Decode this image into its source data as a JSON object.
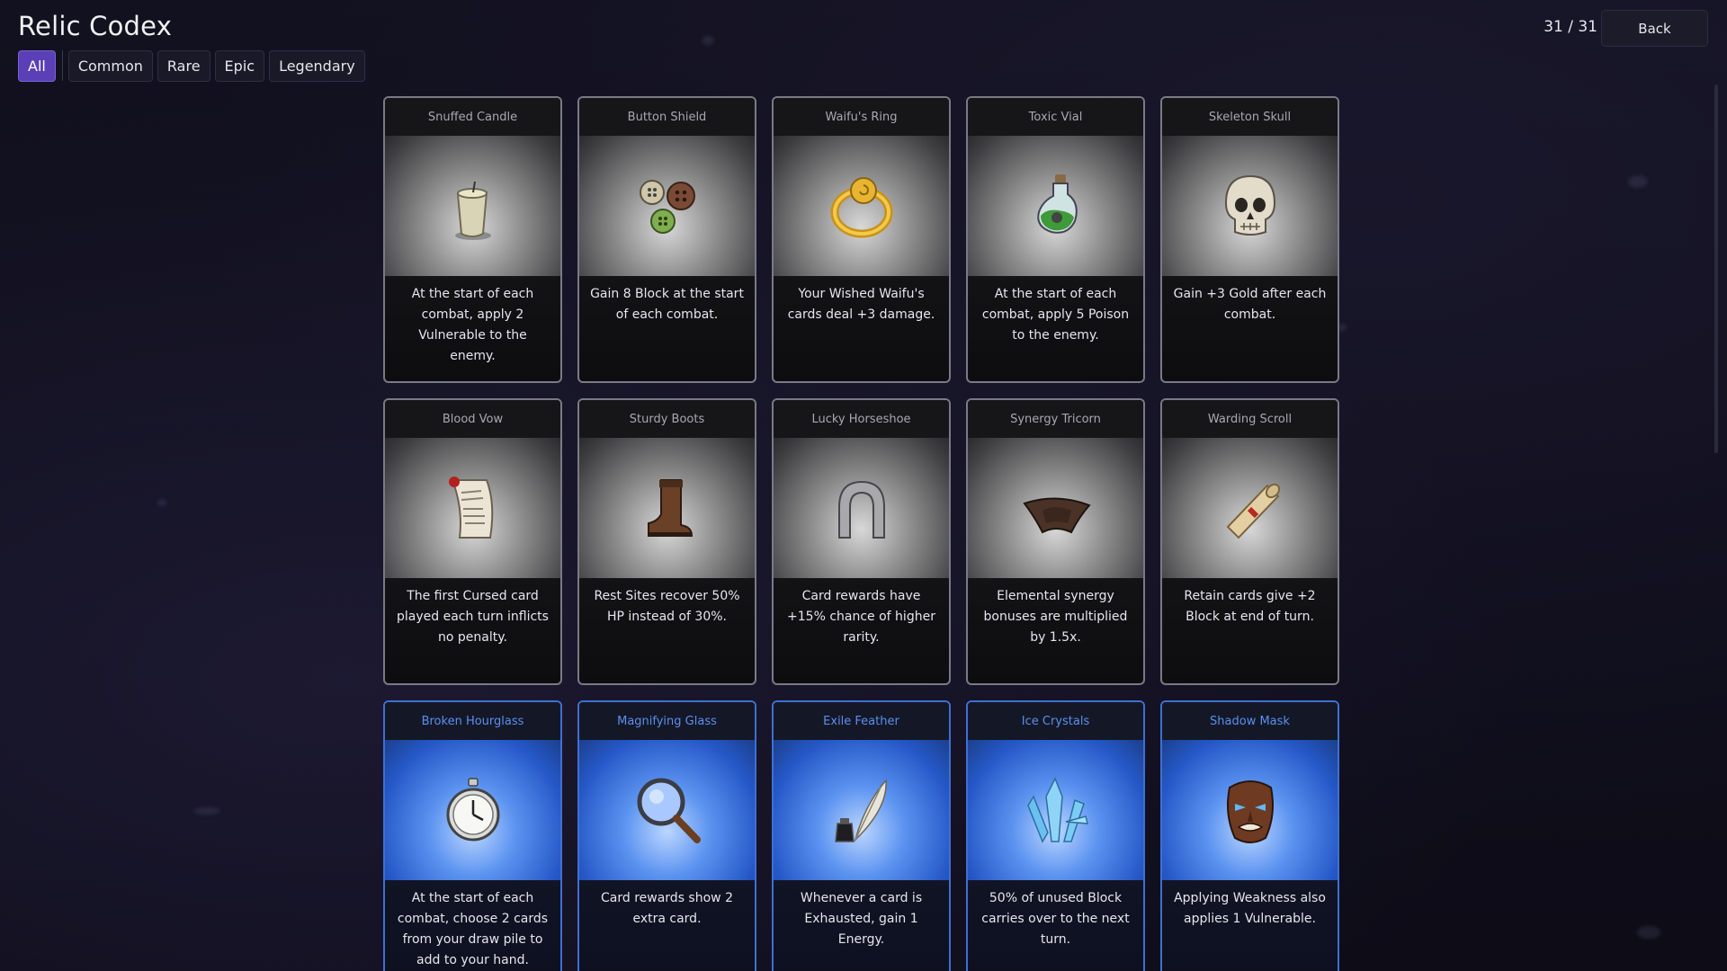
{
  "header": {
    "title": "Relic Codex",
    "counter": "31 / 31",
    "back_label": "Back"
  },
  "filters": [
    {
      "label": "All",
      "active": true
    },
    {
      "label": "Common",
      "active": false
    },
    {
      "label": "Rare",
      "active": false
    },
    {
      "label": "Epic",
      "active": false
    },
    {
      "label": "Legendary",
      "active": false
    }
  ],
  "colors": {
    "accent": "#5b3fb6",
    "common_border": "#7a7a86",
    "rare_border": "#3f6fd3",
    "rare_name": "#5d8ef0"
  },
  "relics": [
    {
      "name": "Snuffed Candle",
      "icon": "candle-icon",
      "rarity": "common",
      "description": "At the start of each combat, apply 2 Vulnerable to the enemy."
    },
    {
      "name": "Button Shield",
      "icon": "buttons-icon",
      "rarity": "common",
      "description": "Gain 8 Block at the start of each combat."
    },
    {
      "name": "Waifu's Ring",
      "icon": "ring-icon",
      "rarity": "common",
      "description": "Your Wished Waifu's cards deal +3 damage."
    },
    {
      "name": "Toxic Vial",
      "icon": "potion-icon",
      "rarity": "common",
      "description": "At the start of each combat, apply 5 Poison to the enemy."
    },
    {
      "name": "Skeleton Skull",
      "icon": "skull-icon",
      "rarity": "common",
      "description": "Gain +3 Gold after each combat."
    },
    {
      "name": "Blood Vow",
      "icon": "contract-scroll-icon",
      "rarity": "common",
      "description": "The first Cursed card played each turn inflicts no penalty."
    },
    {
      "name": "Sturdy Boots",
      "icon": "boot-icon",
      "rarity": "common",
      "description": "Rest Sites recover 50% HP instead of 30%."
    },
    {
      "name": "Lucky Horseshoe",
      "icon": "horseshoe-icon",
      "rarity": "common",
      "description": "Card rewards have +15% chance of higher rarity."
    },
    {
      "name": "Synergy Tricorn",
      "icon": "tricorn-hat-icon",
      "rarity": "common",
      "description": "Elemental synergy bonuses are multiplied by 1.5x."
    },
    {
      "name": "Warding Scroll",
      "icon": "scroll-icon",
      "rarity": "common",
      "description": "Retain cards give +2 Block at end of turn."
    },
    {
      "name": "Broken Hourglass",
      "icon": "stopwatch-icon",
      "rarity": "rare",
      "description": "At the start of each combat, choose 2 cards from your draw pile to add to your hand."
    },
    {
      "name": "Magnifying Glass",
      "icon": "magnifying-glass-icon",
      "rarity": "rare",
      "description": "Card rewards show 2 extra card."
    },
    {
      "name": "Exile Feather",
      "icon": "quill-ink-icon",
      "rarity": "rare",
      "description": "Whenever a card is Exhausted, gain 1 Energy."
    },
    {
      "name": "Ice Crystals",
      "icon": "ice-crystal-icon",
      "rarity": "rare",
      "description": "50% of unused Block carries over to the next turn."
    },
    {
      "name": "Shadow Mask",
      "icon": "tribal-mask-icon",
      "rarity": "rare",
      "description": "Applying Weakness also applies 1 Vulnerable."
    }
  ]
}
